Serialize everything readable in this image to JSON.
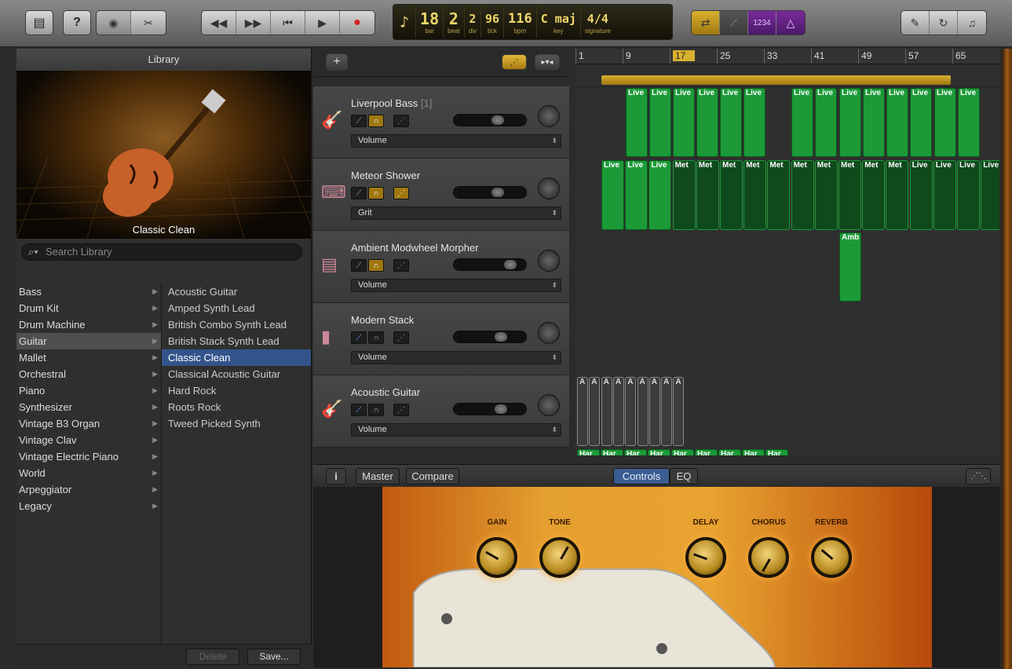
{
  "toolbar": {
    "lcd": {
      "bar": "18",
      "bar_label": "bar",
      "beat": "2",
      "beat_label": "beat",
      "div": "2",
      "div_label": "div",
      "tick": "96",
      "tick_label": "tick",
      "bpm": "116",
      "bpm_label": "bpm",
      "key": "C maj",
      "key_label": "key",
      "signature": "4/4",
      "signature_label": "signature"
    },
    "count_in": "1234"
  },
  "library": {
    "title": "Library",
    "preset_caption": "Classic Clean",
    "search_placeholder": "Search Library",
    "categories": [
      "Bass",
      "Drum Kit",
      "Drum Machine",
      "Guitar",
      "Mallet",
      "Orchestral",
      "Piano",
      "Synthesizer",
      "Vintage B3 Organ",
      "Vintage Clav",
      "Vintage Electric Piano",
      "World",
      "Arpeggiator",
      "Legacy"
    ],
    "selected_category": "Guitar",
    "presets": [
      "Acoustic Guitar",
      "Amped Synth Lead",
      "British Combo Synth Lead",
      "British Stack Synth Lead",
      "Classic Clean",
      "Classical Acoustic Guitar",
      "Hard Rock",
      "Roots Rock",
      "Tweed Picked Synth"
    ],
    "selected_preset": "Classic Clean",
    "delete_label": "Delete",
    "save_label": "Save..."
  },
  "tracks": [
    {
      "name": "Liverpool Bass",
      "suffix": "[1]",
      "automation": "Volume"
    },
    {
      "name": "Meteor Shower",
      "suffix": "",
      "automation": "Grit"
    },
    {
      "name": "Ambient Modwheel Morpher",
      "suffix": "",
      "automation": "Volume"
    },
    {
      "name": "Modern Stack",
      "suffix": "",
      "automation": "Volume"
    },
    {
      "name": "Acoustic Guitar",
      "suffix": "",
      "automation": "Volume"
    }
  ],
  "ruler": {
    "bars": [
      "1",
      "9",
      "17",
      "25",
      "33",
      "41",
      "49",
      "57",
      "65"
    ],
    "playhead_bar": "17"
  },
  "regions": {
    "live": "Live",
    "met": "Met",
    "amb": "Amb",
    "a": "A",
    "har": "Har"
  },
  "smart_controls": {
    "master_label": "Master",
    "compare_label": "Compare",
    "controls_tab": "Controls",
    "eq_tab": "EQ",
    "knobs": [
      "GAIN",
      "TONE",
      "DELAY",
      "CHORUS",
      "REVERB"
    ]
  },
  "colors": {
    "accent_blue": "#33548a",
    "region_green": "#1c9a38",
    "lcd_amber": "#f0d66a"
  }
}
